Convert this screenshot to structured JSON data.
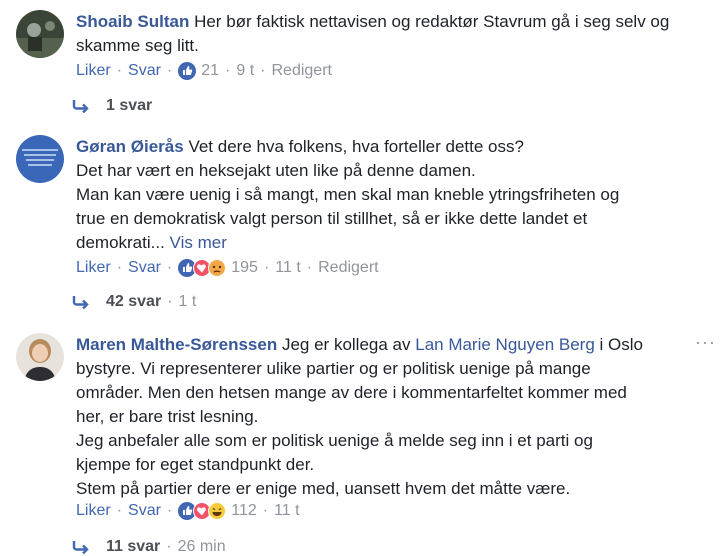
{
  "comments": [
    {
      "author": "Shoaib Sultan",
      "text": "Her bør faktisk nettavisen og redaktør Stavrum gå i seg selv og skamme seg litt.",
      "actions": {
        "like": "Liker",
        "reply": "Svar",
        "count": "21",
        "time": "9 t",
        "edited": "Redigert"
      },
      "reactions": [
        "like-icon"
      ],
      "replies": {
        "label": "1 svar"
      }
    },
    {
      "author": "Gøran Øierås",
      "text_lines": [
        "Vet dere hva folkens, hva forteller dette oss?",
        "Det har vært en heksejakt uten like på denne damen.",
        "Man kan være uenig i så mangt, men skal man kneble ytringsfriheten og",
        "true en demokratisk valgt person til stillhet, så er ikke dette landet et",
        "demokrati... "
      ],
      "see_more": "Vis mer",
      "actions": {
        "like": "Liker",
        "reply": "Svar",
        "count": "195",
        "time": "11 t",
        "edited": "Redigert"
      },
      "reactions": [
        "like-icon",
        "love-icon",
        "angry-icon"
      ],
      "replies": {
        "label": "42 svar",
        "time": "1 t"
      }
    },
    {
      "author": "Maren Malthe-Sørenssen",
      "text_intro": "Jeg er kollega av",
      "mention": "Lan Marie Nguyen Berg",
      "text_after_mention": "i Oslo",
      "text_lines": [
        "bystyre. Vi representerer ulike partier og er politisk uenige på mange",
        "områder. Men den hetsen mange av dere i kommentarfeltet kommer med",
        "her, er bare trist lesning.",
        "Jeg anbefaler alle som er politisk uenige å melde seg inn i et parti og",
        "kjempe for eget standpunkt der.",
        "Stem på partier dere er enige med, uansett hvem det måtte være."
      ],
      "actions": {
        "like": "Liker",
        "reply": "Svar",
        "count": "112",
        "time": "11 t"
      },
      "reactions": [
        "like-icon",
        "love-icon",
        "haha-icon"
      ],
      "replies": {
        "label": "11 svar",
        "time": "26 min"
      }
    }
  ],
  "colors": {
    "name": "#385898",
    "meta": "#90949c",
    "like": "#4267b2",
    "love": "#f25268",
    "angry": "#f2a848"
  }
}
